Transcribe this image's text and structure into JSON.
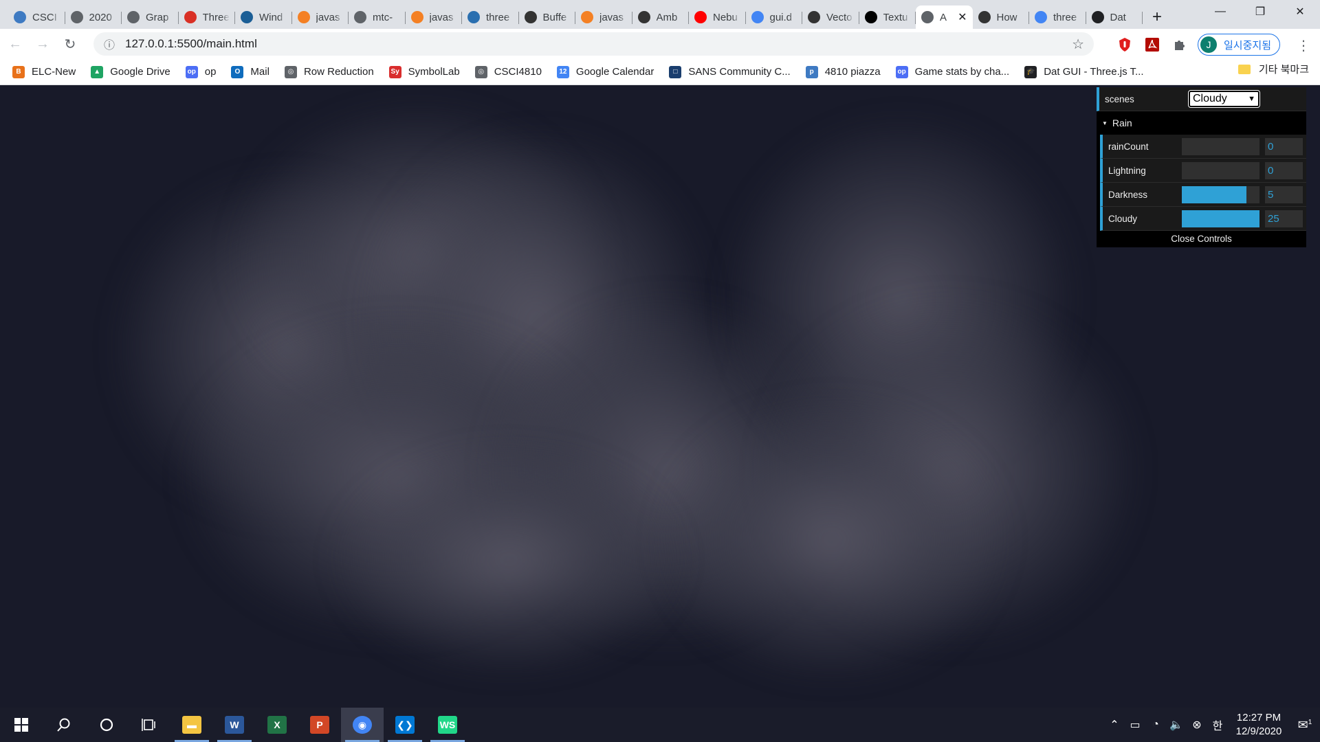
{
  "browser": {
    "tabs": [
      {
        "label": "CSCI",
        "icon": "piazza-icon",
        "color": "#3e7ac2"
      },
      {
        "label": "2020",
        "icon": "globe-icon",
        "color": "#5f6368"
      },
      {
        "label": "Grap",
        "icon": "globe-icon",
        "color": "#5f6368"
      },
      {
        "label": "Three",
        "icon": "no-entry-icon",
        "color": "#d93025"
      },
      {
        "label": "Wind",
        "icon": "bird-icon",
        "color": "#1b5e96"
      },
      {
        "label": "javas",
        "icon": "stackoverflow-icon",
        "color": "#f48024"
      },
      {
        "label": "mtc-",
        "icon": "globe-icon",
        "color": "#5f6368"
      },
      {
        "label": "javas",
        "icon": "stackoverflow-icon",
        "color": "#f48024"
      },
      {
        "label": "three",
        "icon": "monster-icon",
        "color": "#2a6fb0"
      },
      {
        "label": "Buffe",
        "icon": "threejs-icon",
        "color": "#333333"
      },
      {
        "label": "javas",
        "icon": "stackoverflow-icon",
        "color": "#f48024"
      },
      {
        "label": "Amb",
        "icon": "threejs-icon",
        "color": "#333333"
      },
      {
        "label": "Nebu",
        "icon": "youtube-icon",
        "color": "#ff0000"
      },
      {
        "label": "gui.d",
        "icon": "google-icon",
        "color": "#4285f4"
      },
      {
        "label": "Vecto",
        "icon": "threejs-icon",
        "color": "#333333"
      },
      {
        "label": "Textu",
        "icon": "wikipedia-icon",
        "color": "#000000"
      },
      {
        "label": "A",
        "icon": "globe-icon",
        "color": "#5f6368",
        "active": true
      },
      {
        "label": "How",
        "icon": "threejs-icon",
        "color": "#333333"
      },
      {
        "label": "three",
        "icon": "google-icon",
        "color": "#4285f4"
      },
      {
        "label": "Dat",
        "icon": "graduation-cap-icon",
        "color": "#202124"
      }
    ],
    "new_tab": "+",
    "url": "127.0.0.1:5500/main.html",
    "profile_label": "일시중지됨",
    "profile_initial": "J",
    "bookmarks": [
      {
        "label": "ELC-New",
        "icon": "elc-icon",
        "color": "#e8711a",
        "glyph": "B"
      },
      {
        "label": "Google Drive",
        "icon": "google-drive-icon",
        "color": "#1fa463",
        "glyph": "▲"
      },
      {
        "label": "op",
        "icon": "oracle-icon",
        "color": "#4c6ef5",
        "glyph": "op"
      },
      {
        "label": "Mail",
        "icon": "outlook-icon",
        "color": "#0f6cbd",
        "glyph": "O"
      },
      {
        "label": "Row Reduction",
        "icon": "globe-icon",
        "color": "#5f6368",
        "glyph": "◎"
      },
      {
        "label": "SymbolLab",
        "icon": "symbolab-icon",
        "color": "#d92d2d",
        "glyph": "Sy"
      },
      {
        "label": "CSCI4810",
        "icon": "globe-icon",
        "color": "#5f6368",
        "glyph": "◎"
      },
      {
        "label": "Google Calendar",
        "icon": "google-calendar-icon",
        "color": "#4285f4",
        "glyph": "12"
      },
      {
        "label": "SANS Community C...",
        "icon": "sans-icon",
        "color": "#1a3e6e",
        "glyph": "□"
      },
      {
        "label": "4810 piazza",
        "icon": "piazza-icon",
        "color": "#3e7ac2",
        "glyph": "p"
      },
      {
        "label": "Game stats by cha...",
        "icon": "oracle-icon",
        "color": "#4c6ef5",
        "glyph": "op"
      },
      {
        "label": "Dat GUI - Three.js T...",
        "icon": "graduation-cap-icon",
        "color": "#202124",
        "glyph": "🎓"
      }
    ],
    "other_bookmarks": "기타 북마크"
  },
  "gui": {
    "scenes_label": "scenes",
    "scenes_value": "Cloudy",
    "folder_title": "Rain",
    "controls": [
      {
        "name": "rainCount",
        "value": "0",
        "fill": 0
      },
      {
        "name": "Lightning",
        "value": "0",
        "fill": 0
      },
      {
        "name": "Darkness",
        "value": "5",
        "fill": 0.83
      },
      {
        "name": "Cloudy",
        "value": "25",
        "fill": 1.0
      }
    ],
    "close_label": "Close Controls"
  },
  "taskbar": {
    "apps": [
      {
        "name": "file-explorer",
        "icon": "folder-icon",
        "color": "#f4c542",
        "glyph": "▬",
        "open": true
      },
      {
        "name": "word",
        "icon": "word-icon",
        "color": "#2b579a",
        "glyph": "W",
        "open": true
      },
      {
        "name": "excel",
        "icon": "excel-icon",
        "color": "#217346",
        "glyph": "X",
        "open": false
      },
      {
        "name": "powerpoint",
        "icon": "powerpoint-icon",
        "color": "#d24726",
        "glyph": "P",
        "open": false
      },
      {
        "name": "chrome",
        "icon": "chrome-icon",
        "color": "#4285f4",
        "glyph": "◉",
        "open": true,
        "active": true
      },
      {
        "name": "vscode",
        "icon": "vscode-icon",
        "color": "#0078d4",
        "glyph": "❮❯",
        "open": true
      },
      {
        "name": "webstorm",
        "icon": "webstorm-icon",
        "color": "#21d789",
        "glyph": "WS",
        "open": true
      }
    ],
    "ime": "한",
    "time": "12:27 PM",
    "date": "12/9/2020",
    "notification_count": "1"
  }
}
